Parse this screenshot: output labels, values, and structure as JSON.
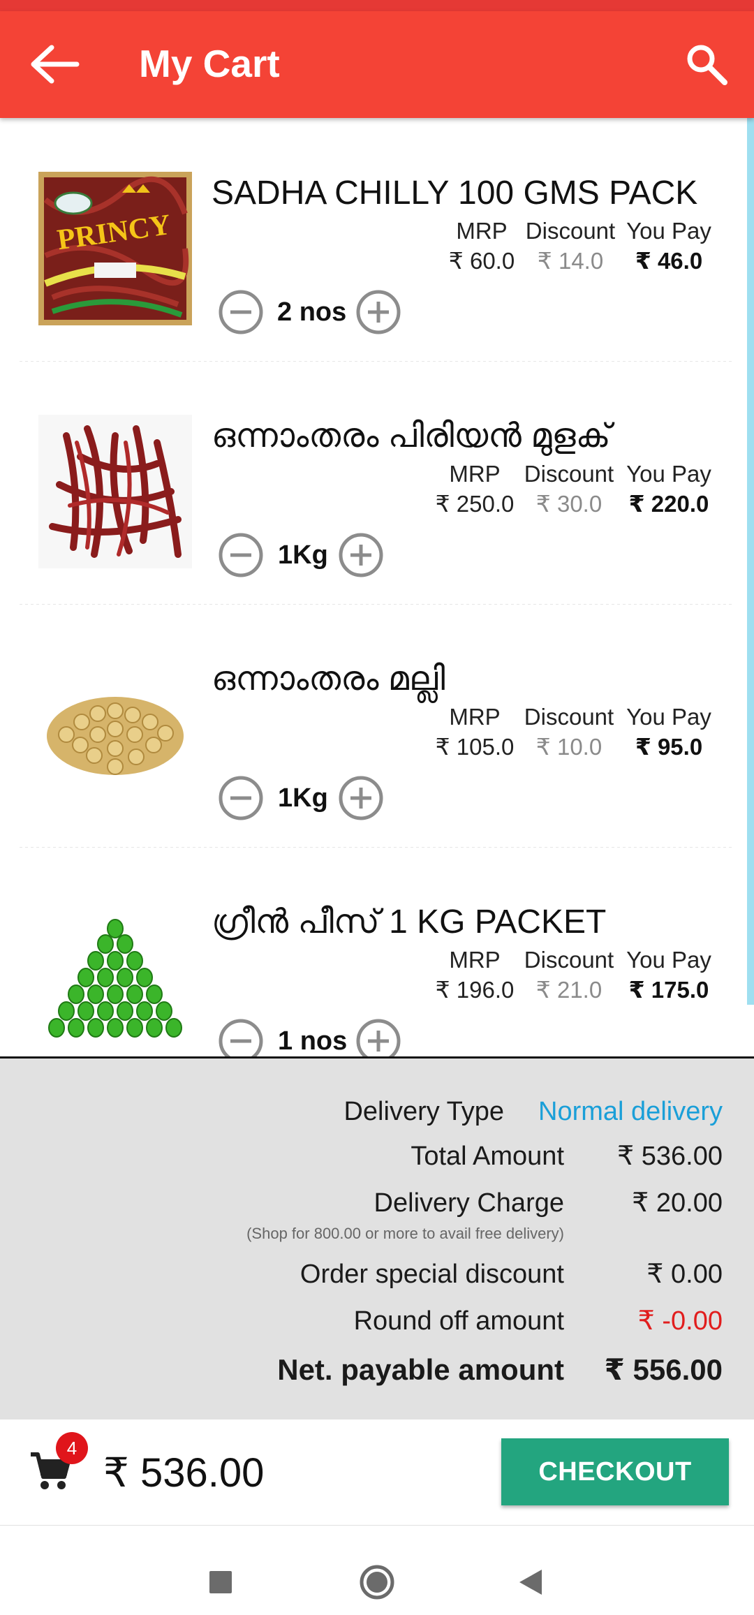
{
  "app_bar": {
    "title": "My Cart",
    "back_icon": "arrow-left-icon",
    "search_icon": "search-icon",
    "color": "#f44336"
  },
  "cart": {
    "column_headers": {
      "mrp": "MRP",
      "discount": "Discount",
      "you_pay": "You Pay"
    },
    "items": [
      {
        "name": "SADHA CHILLY  100 GMS PACK",
        "mrp": "₹ 60.0",
        "discount": "₹ 14.0",
        "you_pay": "₹ 46.0",
        "quantity": "2 nos",
        "image": "chilly-pack-image"
      },
      {
        "name": "ഒന്നാംതരം പിരിയൻ മുളക്",
        "mrp": "₹ 250.0",
        "discount": "₹ 30.0",
        "you_pay": "₹ 220.0",
        "quantity": "1Kg",
        "image": "red-chilli-image"
      },
      {
        "name": "ഒന്നാംതരം മല്ലി",
        "mrp": "₹ 105.0",
        "discount": "₹ 10.0",
        "you_pay": "₹ 95.0",
        "quantity": "1Kg",
        "image": "coriander-image"
      },
      {
        "name": "ഗ്രീൻ പീസ്  1 KG PACKET",
        "mrp": "₹ 196.0",
        "discount": "₹ 21.0",
        "you_pay": "₹ 175.0",
        "quantity": "1 nos",
        "image": "green-peas-image"
      }
    ]
  },
  "summary": {
    "delivery_type_label": "Delivery Type",
    "delivery_type_value": "Normal delivery",
    "total_amount_label": "Total Amount",
    "total_amount_value": "₹ 536.00",
    "delivery_charge_label": "Delivery Charge",
    "delivery_charge_value": "₹ 20.00",
    "free_delivery_note": "(Shop for 800.00 or more to avail free delivery)",
    "special_discount_label": "Order special discount",
    "special_discount_value": "₹ 0.00",
    "round_off_label": "Round off amount",
    "round_off_value": "₹ -0.00",
    "net_payable_label": "Net. payable amount",
    "net_payable_value": "₹ 556.00"
  },
  "bottom_bar": {
    "cart_count": "4",
    "total": "₹ 536.00",
    "checkout_label": "CHECKOUT",
    "checkout_color": "#23a57f"
  },
  "system_nav": {
    "icons": [
      "recents-square-icon",
      "home-circle-icon",
      "back-triangle-icon"
    ]
  }
}
